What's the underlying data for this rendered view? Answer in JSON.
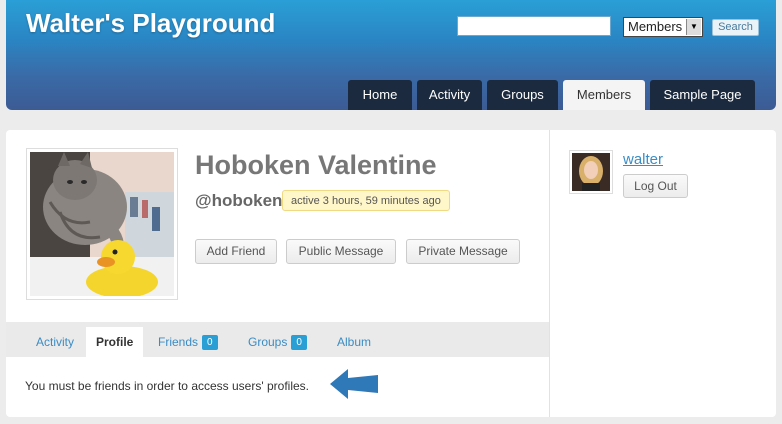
{
  "site": {
    "title": "Walter's Playground"
  },
  "search": {
    "value": "",
    "scope": "Members",
    "button": "Search"
  },
  "nav": [
    {
      "label": "Home"
    },
    {
      "label": "Activity"
    },
    {
      "label": "Groups"
    },
    {
      "label": "Members",
      "active": true
    },
    {
      "label": "Sample Page"
    }
  ],
  "profile": {
    "name": "Hoboken Valentine",
    "handle": "@hoboken",
    "last_active": "active 3 hours, 59 minutes ago",
    "buttons": {
      "add_friend": "Add Friend",
      "public_message": "Public Message",
      "private_message": "Private Message"
    },
    "tabs": [
      {
        "label": "Activity"
      },
      {
        "label": "Profile",
        "active": true
      },
      {
        "label": "Friends",
        "count": "0"
      },
      {
        "label": "Groups",
        "count": "0"
      },
      {
        "label": "Album"
      }
    ],
    "message": "You must be friends in order to access users' profiles."
  },
  "sidebar": {
    "username": "walter",
    "logout": "Log Out"
  },
  "colors": {
    "accent": "#2a9fd6",
    "nav_bg": "#1b2a3e",
    "link": "#3a8cc4",
    "arrow": "#2f79b8"
  }
}
